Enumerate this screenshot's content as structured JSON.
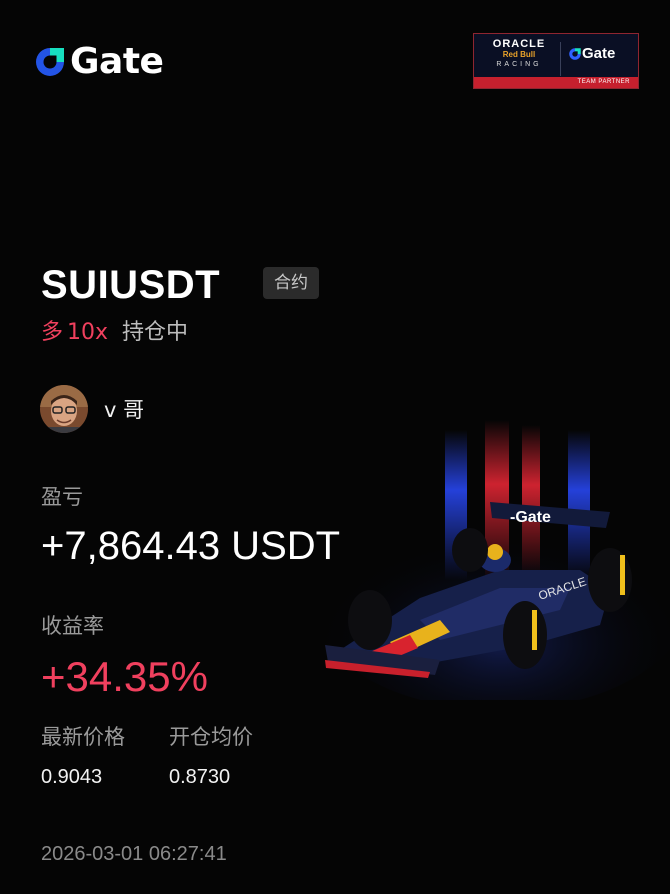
{
  "brand": {
    "name": "Gate",
    "logo_icon": "gate-logo-icon"
  },
  "partner_badge": {
    "oracle": "ORACLE",
    "redbull": "Red Bull",
    "racing": "RACING",
    "gate": "Gate",
    "tagline": "TEAM PARTNER"
  },
  "trade": {
    "symbol": "SUIUSDT",
    "type_tag": "合约",
    "direction": "多",
    "leverage": "10x",
    "status": "持仓中"
  },
  "user": {
    "name": "v 哥",
    "avatar_icon": "user-avatar"
  },
  "pnl": {
    "label": "盈亏",
    "value": "+7,864.43 USDT"
  },
  "roi": {
    "label": "收益率",
    "value": "+34.35%"
  },
  "prices": {
    "latest_label": "最新价格",
    "latest_value": "0.9043",
    "entry_label": "开仓均价",
    "entry_value": "0.8730"
  },
  "timestamp": "2026-03-01 06:27:41",
  "colors": {
    "background": "#050505",
    "accent_red": "#f0405e",
    "gate_blue": "#2354e6",
    "muted_text": "#9a9a9a"
  }
}
